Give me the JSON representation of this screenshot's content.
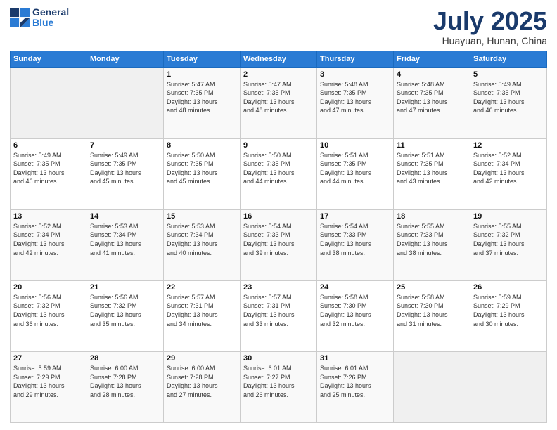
{
  "header": {
    "logo_line1": "General",
    "logo_line2": "Blue",
    "month": "July 2025",
    "location": "Huayuan, Hunan, China"
  },
  "weekdays": [
    "Sunday",
    "Monday",
    "Tuesday",
    "Wednesday",
    "Thursday",
    "Friday",
    "Saturday"
  ],
  "weeks": [
    [
      {
        "day": "",
        "detail": ""
      },
      {
        "day": "",
        "detail": ""
      },
      {
        "day": "1",
        "detail": "Sunrise: 5:47 AM\nSunset: 7:35 PM\nDaylight: 13 hours\nand 48 minutes."
      },
      {
        "day": "2",
        "detail": "Sunrise: 5:47 AM\nSunset: 7:35 PM\nDaylight: 13 hours\nand 48 minutes."
      },
      {
        "day": "3",
        "detail": "Sunrise: 5:48 AM\nSunset: 7:35 PM\nDaylight: 13 hours\nand 47 minutes."
      },
      {
        "day": "4",
        "detail": "Sunrise: 5:48 AM\nSunset: 7:35 PM\nDaylight: 13 hours\nand 47 minutes."
      },
      {
        "day": "5",
        "detail": "Sunrise: 5:49 AM\nSunset: 7:35 PM\nDaylight: 13 hours\nand 46 minutes."
      }
    ],
    [
      {
        "day": "6",
        "detail": "Sunrise: 5:49 AM\nSunset: 7:35 PM\nDaylight: 13 hours\nand 46 minutes."
      },
      {
        "day": "7",
        "detail": "Sunrise: 5:49 AM\nSunset: 7:35 PM\nDaylight: 13 hours\nand 45 minutes."
      },
      {
        "day": "8",
        "detail": "Sunrise: 5:50 AM\nSunset: 7:35 PM\nDaylight: 13 hours\nand 45 minutes."
      },
      {
        "day": "9",
        "detail": "Sunrise: 5:50 AM\nSunset: 7:35 PM\nDaylight: 13 hours\nand 44 minutes."
      },
      {
        "day": "10",
        "detail": "Sunrise: 5:51 AM\nSunset: 7:35 PM\nDaylight: 13 hours\nand 44 minutes."
      },
      {
        "day": "11",
        "detail": "Sunrise: 5:51 AM\nSunset: 7:35 PM\nDaylight: 13 hours\nand 43 minutes."
      },
      {
        "day": "12",
        "detail": "Sunrise: 5:52 AM\nSunset: 7:34 PM\nDaylight: 13 hours\nand 42 minutes."
      }
    ],
    [
      {
        "day": "13",
        "detail": "Sunrise: 5:52 AM\nSunset: 7:34 PM\nDaylight: 13 hours\nand 42 minutes."
      },
      {
        "day": "14",
        "detail": "Sunrise: 5:53 AM\nSunset: 7:34 PM\nDaylight: 13 hours\nand 41 minutes."
      },
      {
        "day": "15",
        "detail": "Sunrise: 5:53 AM\nSunset: 7:34 PM\nDaylight: 13 hours\nand 40 minutes."
      },
      {
        "day": "16",
        "detail": "Sunrise: 5:54 AM\nSunset: 7:33 PM\nDaylight: 13 hours\nand 39 minutes."
      },
      {
        "day": "17",
        "detail": "Sunrise: 5:54 AM\nSunset: 7:33 PM\nDaylight: 13 hours\nand 38 minutes."
      },
      {
        "day": "18",
        "detail": "Sunrise: 5:55 AM\nSunset: 7:33 PM\nDaylight: 13 hours\nand 38 minutes."
      },
      {
        "day": "19",
        "detail": "Sunrise: 5:55 AM\nSunset: 7:32 PM\nDaylight: 13 hours\nand 37 minutes."
      }
    ],
    [
      {
        "day": "20",
        "detail": "Sunrise: 5:56 AM\nSunset: 7:32 PM\nDaylight: 13 hours\nand 36 minutes."
      },
      {
        "day": "21",
        "detail": "Sunrise: 5:56 AM\nSunset: 7:32 PM\nDaylight: 13 hours\nand 35 minutes."
      },
      {
        "day": "22",
        "detail": "Sunrise: 5:57 AM\nSunset: 7:31 PM\nDaylight: 13 hours\nand 34 minutes."
      },
      {
        "day": "23",
        "detail": "Sunrise: 5:57 AM\nSunset: 7:31 PM\nDaylight: 13 hours\nand 33 minutes."
      },
      {
        "day": "24",
        "detail": "Sunrise: 5:58 AM\nSunset: 7:30 PM\nDaylight: 13 hours\nand 32 minutes."
      },
      {
        "day": "25",
        "detail": "Sunrise: 5:58 AM\nSunset: 7:30 PM\nDaylight: 13 hours\nand 31 minutes."
      },
      {
        "day": "26",
        "detail": "Sunrise: 5:59 AM\nSunset: 7:29 PM\nDaylight: 13 hours\nand 30 minutes."
      }
    ],
    [
      {
        "day": "27",
        "detail": "Sunrise: 5:59 AM\nSunset: 7:29 PM\nDaylight: 13 hours\nand 29 minutes."
      },
      {
        "day": "28",
        "detail": "Sunrise: 6:00 AM\nSunset: 7:28 PM\nDaylight: 13 hours\nand 28 minutes."
      },
      {
        "day": "29",
        "detail": "Sunrise: 6:00 AM\nSunset: 7:28 PM\nDaylight: 13 hours\nand 27 minutes."
      },
      {
        "day": "30",
        "detail": "Sunrise: 6:01 AM\nSunset: 7:27 PM\nDaylight: 13 hours\nand 26 minutes."
      },
      {
        "day": "31",
        "detail": "Sunrise: 6:01 AM\nSunset: 7:26 PM\nDaylight: 13 hours\nand 25 minutes."
      },
      {
        "day": "",
        "detail": ""
      },
      {
        "day": "",
        "detail": ""
      }
    ]
  ]
}
